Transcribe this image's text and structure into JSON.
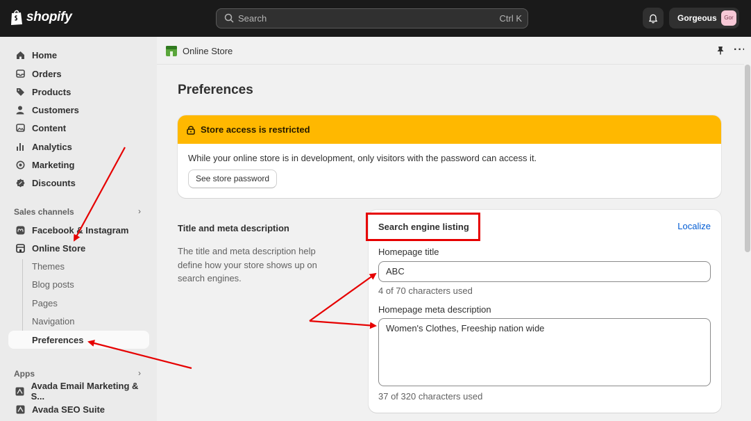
{
  "topbar": {
    "logo_text": "shopify",
    "search_placeholder": "Search",
    "search_shortcut": "Ctrl K",
    "store_name": "Gorgeous",
    "store_avatar": "Gor"
  },
  "sidebar": {
    "items": [
      {
        "label": "Home",
        "icon": "home-icon"
      },
      {
        "label": "Orders",
        "icon": "inbox-icon"
      },
      {
        "label": "Products",
        "icon": "tag-icon"
      },
      {
        "label": "Customers",
        "icon": "person-icon"
      },
      {
        "label": "Content",
        "icon": "image-icon"
      },
      {
        "label": "Analytics",
        "icon": "bar-chart-icon"
      },
      {
        "label": "Marketing",
        "icon": "target-icon"
      },
      {
        "label": "Discounts",
        "icon": "discount-icon"
      }
    ],
    "sales_channels_title": "Sales channels",
    "channels": [
      {
        "label": "Facebook & Instagram",
        "icon": "meta-icon"
      },
      {
        "label": "Online Store",
        "icon": "store-icon"
      }
    ],
    "online_store_sub": [
      "Themes",
      "Blog posts",
      "Pages",
      "Navigation",
      "Preferences"
    ],
    "apps_title": "Apps",
    "apps": [
      {
        "label": "Avada Email Marketing & S...",
        "icon": "avada-icon"
      },
      {
        "label": "Avada SEO Suite",
        "icon": "avada-icon"
      }
    ]
  },
  "breadcrumb": {
    "label": "Online Store"
  },
  "page": {
    "title": "Preferences",
    "banner": {
      "title": "Store access is restricted",
      "body": "While your online store is in development, only visitors with the password can access it.",
      "button": "See store password"
    },
    "section": {
      "title": "Title and meta description",
      "description": "The title and meta description help define how your store shows up on search engines."
    },
    "card": {
      "title": "Search engine listing",
      "link": "Localize",
      "homepage_title_label": "Homepage title",
      "homepage_title_value": "ABC",
      "homepage_title_help": "4 of 70 characters used",
      "meta_label": "Homepage meta description",
      "meta_value": "Women's Clothes, Freeship nation wide",
      "meta_help": "37 of 320 characters used"
    }
  },
  "colors": {
    "topbar": "#1a1a1a",
    "banner_warning": "#ffb800",
    "link": "#005bd3",
    "annotation": "#e60000"
  }
}
